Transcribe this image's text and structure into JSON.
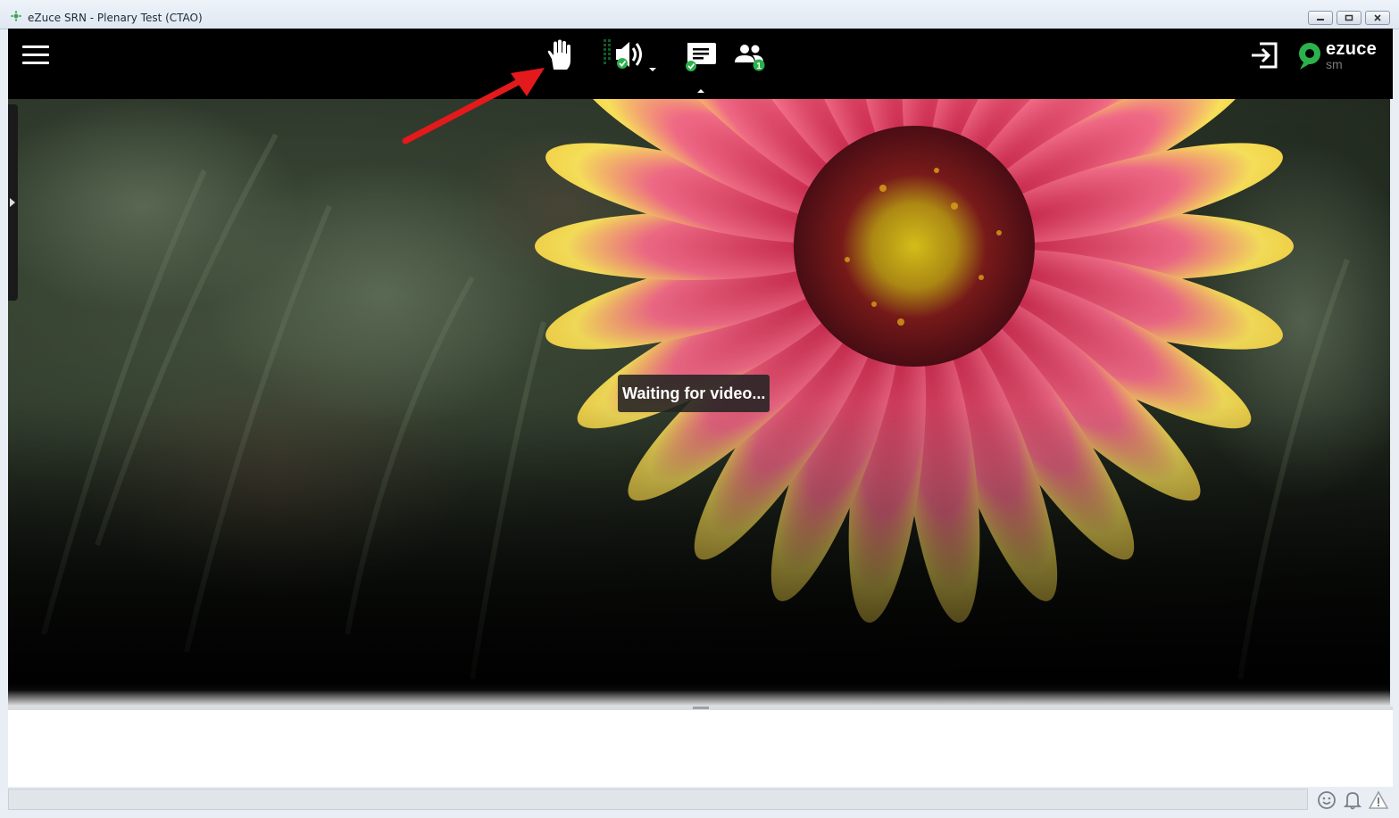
{
  "window": {
    "title": "eZuce SRN - Plenary Test (CTAO)",
    "controls": [
      "minimize",
      "restore",
      "close"
    ]
  },
  "toolbar": {
    "left": [
      "menu-icon"
    ],
    "center": [
      {
        "name": "raise-hand-icon"
      },
      {
        "name": "speaker-icon",
        "status": "check",
        "has_dropdown": true
      },
      {
        "name": "chat-icon",
        "status": "check"
      },
      {
        "name": "participants-icon",
        "badge": "1"
      }
    ],
    "right": [
      "exit-icon"
    ],
    "logo": {
      "text": "ezuce",
      "subtext": "sm"
    }
  },
  "video": {
    "status_text": "Waiting for video..."
  },
  "annotation": {
    "arrow_color": "#e3191c",
    "points_to": "raise-hand-icon"
  },
  "bottom_bar": {
    "icons": [
      "emoji-icon",
      "bell-icon",
      "warning-icon"
    ]
  },
  "colors": {
    "toolbar": "#000000",
    "accent_green": "#2bb24c",
    "arrow_red": "#e3191c"
  }
}
